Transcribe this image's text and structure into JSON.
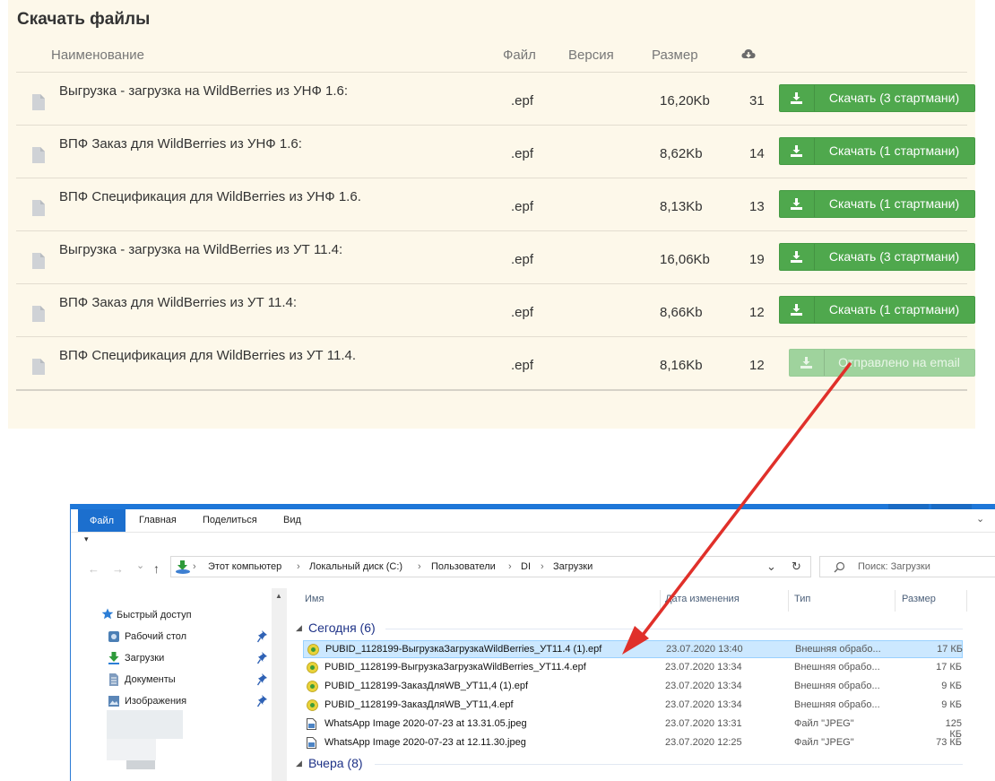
{
  "panel": {
    "title": "Скачать файлы",
    "columns": {
      "name": "Наименование",
      "file": "Файл",
      "version": "Версия",
      "size": "Размер",
      "downloads_icon": "cloud-download-icon"
    },
    "rows": [
      {
        "name": "Выгрузка - загрузка на WildBerries из УНФ 1.6:",
        "ext": ".epf",
        "size": "16,20Kb",
        "count": "31",
        "button": "Скачать (3 стартмани)",
        "disabled": false
      },
      {
        "name": "ВПФ Заказ для WildBerries из УНФ 1.6:",
        "ext": ".epf",
        "size": "8,62Kb",
        "count": "14",
        "button": "Скачать (1 стартмани)",
        "disabled": false
      },
      {
        "name": "ВПФ Спецификация для WildBerries из УНФ 1.6.",
        "ext": ".epf",
        "size": "8,13Kb",
        "count": "13",
        "button": "Скачать (1 стартмани)",
        "disabled": false
      },
      {
        "name": "Выгрузка - загрузка на WildBerries из УТ 11.4:",
        "ext": ".epf",
        "size": "16,06Kb",
        "count": "19",
        "button": "Скачать (3 стартмани)",
        "disabled": false
      },
      {
        "name": "ВПФ Заказ для WildBerries из УТ 11.4:",
        "ext": ".epf",
        "size": "8,66Kb",
        "count": "12",
        "button": "Скачать (1 стартмани)",
        "disabled": false
      },
      {
        "name": "ВПФ Спецификация для WildBerries из УТ 11.4.",
        "ext": ".epf",
        "size": "8,16Kb",
        "count": "12",
        "button": "Отправлено на email",
        "disabled": true
      }
    ],
    "colors": {
      "button": "#4fa84d",
      "button_disabled": "#9fd39d",
      "background": "#fdf8ea"
    }
  },
  "explorer": {
    "ribbon_tabs": [
      "Файл",
      "Главная",
      "Поделиться",
      "Вид"
    ],
    "qat": "▾",
    "nav_icons": {
      "back": "←",
      "forward": "→",
      "recent": "⌄",
      "up": "↑",
      "dropdown": "⌄",
      "refresh": "↻"
    },
    "breadcrumb": [
      "Этот компьютер",
      "Локальный диск (C:)",
      "Пользователи",
      "DI",
      "Загрузки"
    ],
    "search_placeholder": "Поиск: Загрузки",
    "sidebar": {
      "quick_access": "Быстрый доступ",
      "items": [
        "Рабочий стол",
        "Загрузки",
        "Документы",
        "Изображения"
      ]
    },
    "columns": {
      "name": "Имя",
      "date": "Дата изменения",
      "type": "Тип",
      "size": "Размер"
    },
    "groups": {
      "today": "Сегодня (6)",
      "yesterday": "Вчера (8)"
    },
    "files": [
      {
        "name": "PUBID_1128199-ВыгрузкаЗагрузкаWildBerries_УТ11.4 (1).epf",
        "date": "23.07.2020 13:40",
        "type": "Внешняя обрабо...",
        "size": "17 КБ",
        "icon": "epf-icon",
        "selected": true
      },
      {
        "name": "PUBID_1128199-ВыгрузкаЗагрузкаWildBerries_УТ11.4.epf",
        "date": "23.07.2020 13:34",
        "type": "Внешняя обрабо...",
        "size": "17 КБ",
        "icon": "epf-icon",
        "selected": false
      },
      {
        "name": "PUBID_1128199-ЗаказДляWB_УТ11,4 (1).epf",
        "date": "23.07.2020 13:34",
        "type": "Внешняя обрабо...",
        "size": "9 КБ",
        "icon": "epf-icon",
        "selected": false
      },
      {
        "name": "PUBID_1128199-ЗаказДляWB_УТ11,4.epf",
        "date": "23.07.2020 13:34",
        "type": "Внешняя обрабо...",
        "size": "9 КБ",
        "icon": "epf-icon",
        "selected": false
      },
      {
        "name": "WhatsApp Image 2020-07-23 at 13.31.05.jpeg",
        "date": "23.07.2020 13:31",
        "type": "Файл \"JPEG\"",
        "size": "125 КБ",
        "icon": "jpeg-icon",
        "selected": false
      },
      {
        "name": "WhatsApp Image 2020-07-23 at 12.11.30.jpeg",
        "date": "23.07.2020 12:25",
        "type": "Файл \"JPEG\"",
        "size": "73 КБ",
        "icon": "jpeg-icon",
        "selected": false
      }
    ]
  },
  "annotation_arrow_color": "#e0302a"
}
